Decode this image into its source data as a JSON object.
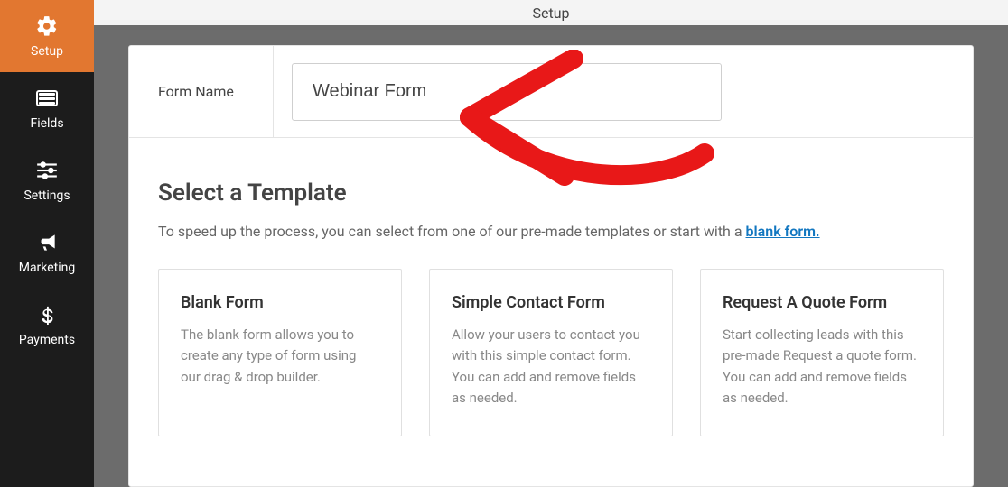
{
  "sidebar": {
    "items": [
      {
        "label": "Setup"
      },
      {
        "label": "Fields"
      },
      {
        "label": "Settings"
      },
      {
        "label": "Marketing"
      },
      {
        "label": "Payments"
      }
    ]
  },
  "topbar": {
    "title": "Setup"
  },
  "form_name": {
    "label": "Form Name",
    "value": "Webinar Form"
  },
  "select_template": {
    "title": "Select a Template",
    "description_pre": "To speed up the process, you can select from one of our pre-made templates or start with a ",
    "blank_link": "blank form."
  },
  "templates": [
    {
      "title": "Blank Form",
      "description": "The blank form allows you to create any type of form using our drag & drop builder."
    },
    {
      "title": "Simple Contact Form",
      "description": "Allow your users to contact you with this simple contact form. You can add and remove fields as needed."
    },
    {
      "title": "Request A Quote Form",
      "description": "Start collecting leads with this pre-made Request a quote form. You can add and remove fields as needed."
    }
  ]
}
